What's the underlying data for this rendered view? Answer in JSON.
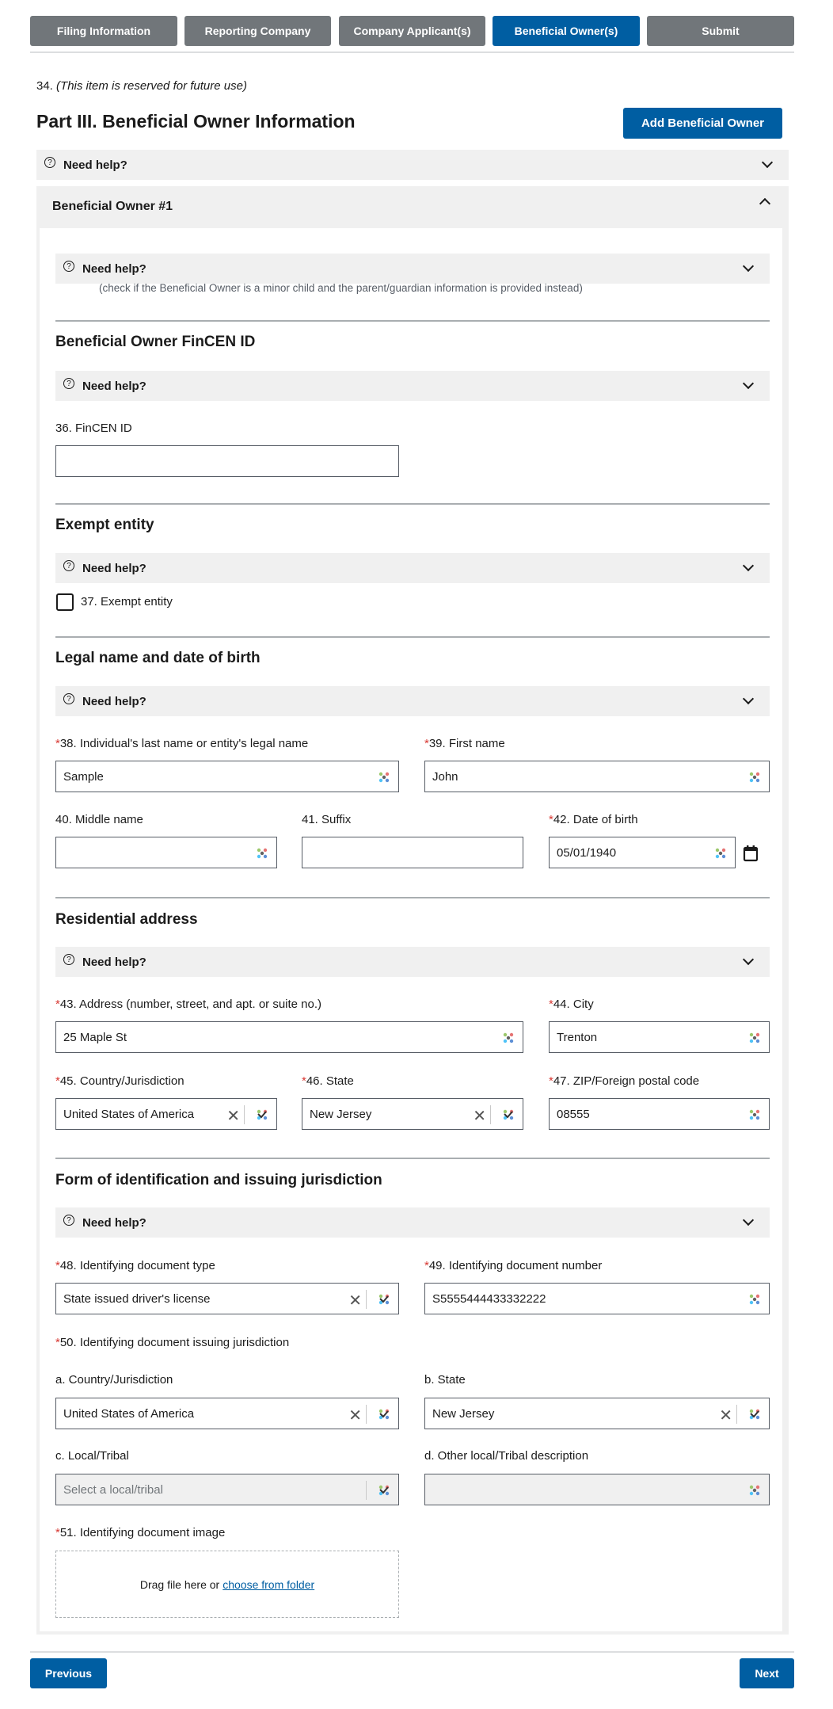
{
  "tabs": [
    {
      "label": "Filing Information",
      "active": false
    },
    {
      "label": "Reporting Company",
      "active": false
    },
    {
      "label": "Company Applicant(s)",
      "active": false
    },
    {
      "label": "Beneficial Owner(s)",
      "active": true
    },
    {
      "label": "Submit",
      "active": false
    }
  ],
  "reserved_item": {
    "number": "34.",
    "text": "(This item is reserved for future use)"
  },
  "part_title": "Part III. Beneficial Owner Information",
  "add_owner_label": "Add Beneficial Owner",
  "help_label": "Need help?",
  "owner": {
    "title": "Beneficial Owner #1",
    "minor_note": "(check if the Beneficial Owner is a minor child and the parent/guardian information is provided instead)",
    "fincen_section": {
      "title": "Beneficial Owner FinCEN ID",
      "field_label": "36. FinCEN ID",
      "value": ""
    },
    "exempt_section": {
      "title": "Exempt entity",
      "checkbox_label": "37. Exempt entity",
      "checked": false
    },
    "legal_section": {
      "title": "Legal name and date of birth",
      "last_name": {
        "label": "38. Individual's last name or entity's legal name",
        "value": "Sample",
        "required": true
      },
      "first_name": {
        "label": "39. First name",
        "value": "John",
        "required": true
      },
      "middle_name": {
        "label": "40. Middle name",
        "value": ""
      },
      "suffix": {
        "label": "41. Suffix",
        "value": ""
      },
      "dob": {
        "label": "42. Date of birth",
        "value": "05/01/1940",
        "required": true
      }
    },
    "address_section": {
      "title": "Residential address",
      "address": {
        "label": "43. Address (number, street, and apt. or suite no.)",
        "value": "25 Maple St"
      },
      "city": {
        "label": "44. City",
        "value": "Trenton"
      },
      "country": {
        "label": "45. Country/Jurisdiction",
        "value": "United States of America"
      },
      "state": {
        "label": "46. State",
        "value": "New Jersey"
      },
      "zip": {
        "label": "47. ZIP/Foreign postal code",
        "value": "08555"
      }
    },
    "id_section": {
      "title": "Form of identification and issuing jurisdiction",
      "doc_type": {
        "label": "48. Identifying document type",
        "value": "State issued driver's license"
      },
      "doc_number": {
        "label": "49. Identifying document number",
        "value": "S5555444433332222"
      },
      "jurisdiction_label": "50. Identifying document issuing jurisdiction",
      "country": {
        "label": "a. Country/Jurisdiction",
        "value": "United States of America"
      },
      "state": {
        "label": "b. State",
        "value": "New Jersey"
      },
      "local": {
        "label": "c. Local/Tribal",
        "placeholder": "Select a local/tribal"
      },
      "other_local": {
        "label": "d. Other local/Tribal description",
        "value": ""
      },
      "image": {
        "label": "51. Identifying document image",
        "drop_text": "Drag file here or",
        "choose_link": "choose from folder"
      }
    }
  },
  "footer": {
    "previous_label": "Previous",
    "next_label": "Next"
  },
  "icons": {
    "help": "question-circle-icon",
    "expand": "chevron-down-icon",
    "collapse": "chevron-up-icon",
    "autofill": "autofill-icon",
    "clear": "close-icon",
    "calendar": "calendar-icon"
  },
  "colors": {
    "primary": "#005ea2",
    "tab_inactive": "#71767a",
    "required": "#d83933",
    "help_bg": "#f0f0f0"
  }
}
